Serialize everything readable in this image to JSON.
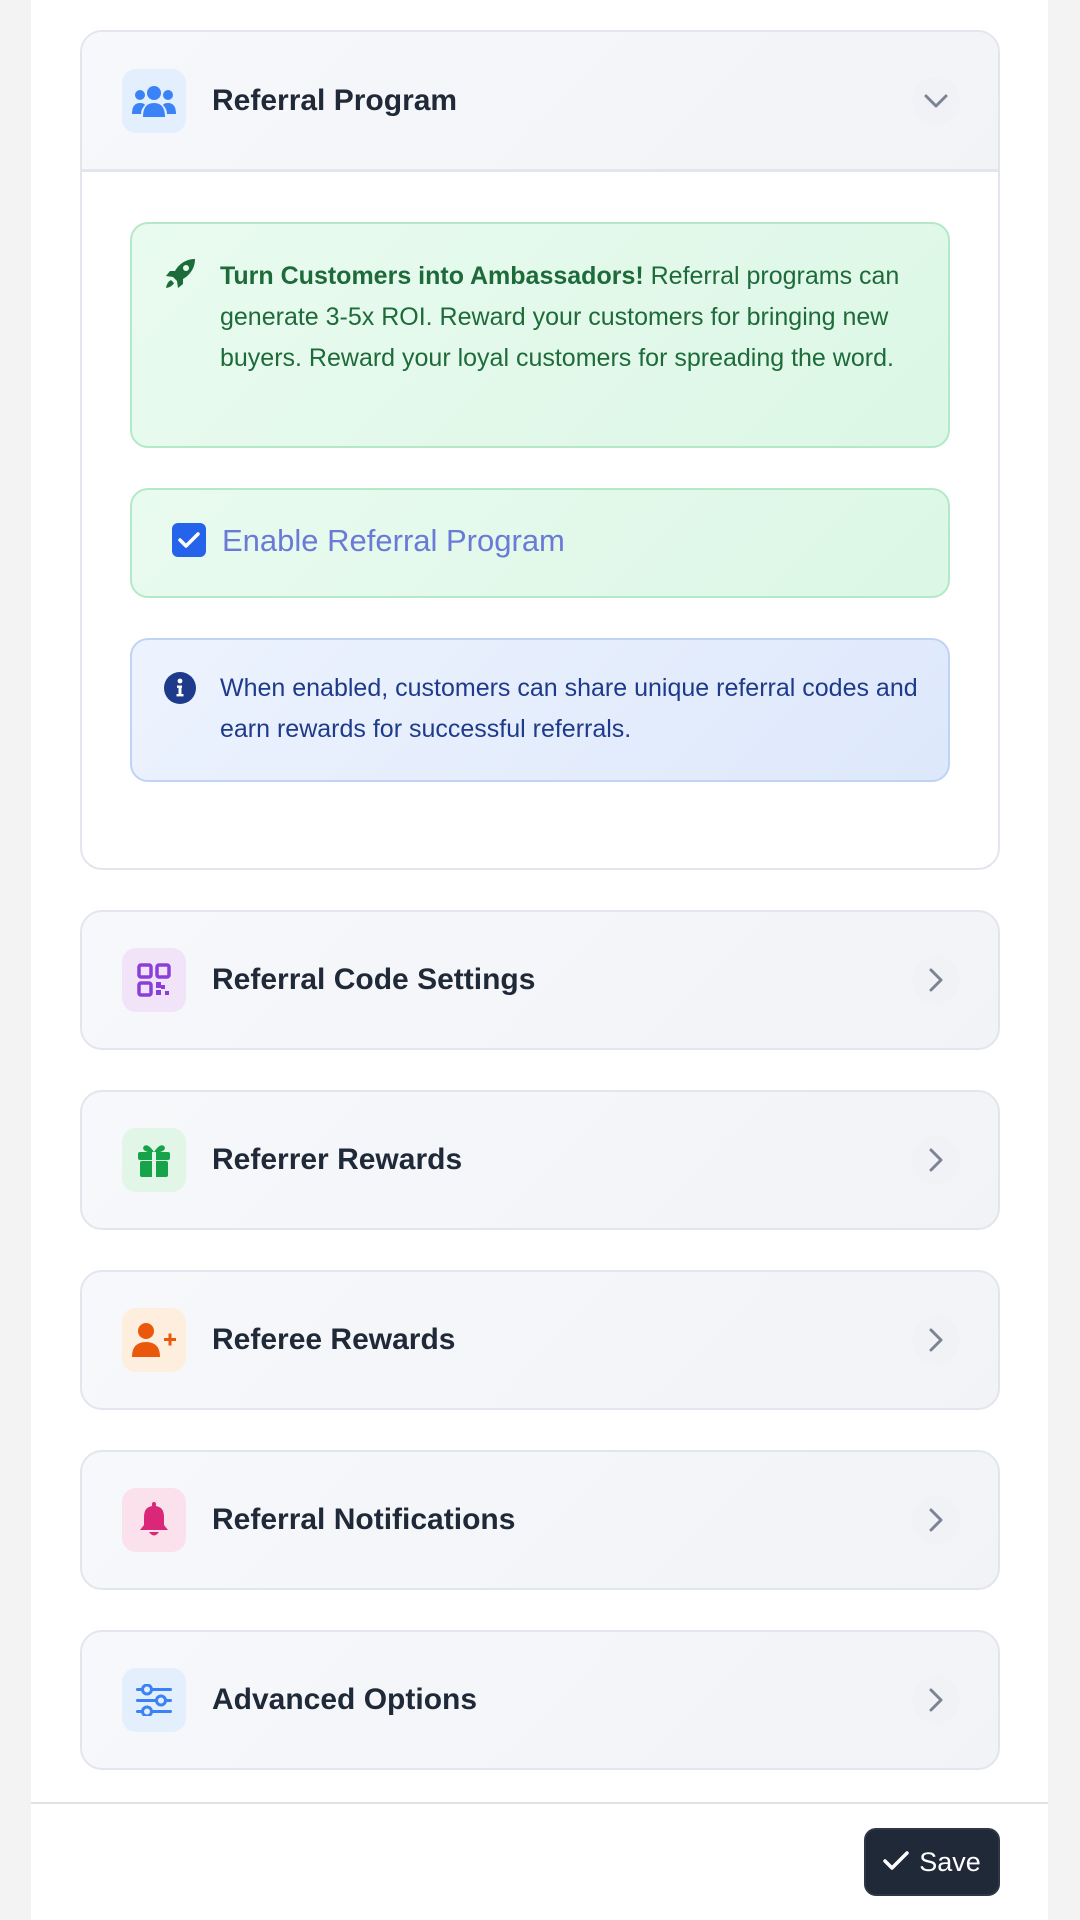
{
  "sections": {
    "referral_program": {
      "title": "Referral Program",
      "promo_bold": "Turn Customers into Ambassadors!",
      "promo_text": " Referral programs can generate 3-5x ROI. Reward your customers for bringing new buyers. Reward your loyal customers for spreading the word.",
      "enable_label": "Enable Referral Program",
      "enabled": true,
      "info_text": "When enabled, customers can share unique referral codes and earn rewards for successful referrals."
    },
    "items": [
      {
        "title": "Referral Code Settings",
        "icon": "qrcode-icon"
      },
      {
        "title": "Referrer Rewards",
        "icon": "gift-icon"
      },
      {
        "title": "Referee Rewards",
        "icon": "user-plus-icon"
      },
      {
        "title": "Referral Notifications",
        "icon": "bell-icon"
      },
      {
        "title": "Advanced Options",
        "icon": "sliders-icon"
      }
    ]
  },
  "footer": {
    "save_label": "Save"
  },
  "colors": {
    "users_icon": "#3b82f6",
    "qrcode_icon": "#8b3fd9",
    "gift_icon": "#16a34a",
    "user_plus_icon": "#ea580c",
    "bell_icon": "#db2777",
    "sliders_icon": "#3b82f6",
    "save_button_bg": "#1f2937"
  }
}
